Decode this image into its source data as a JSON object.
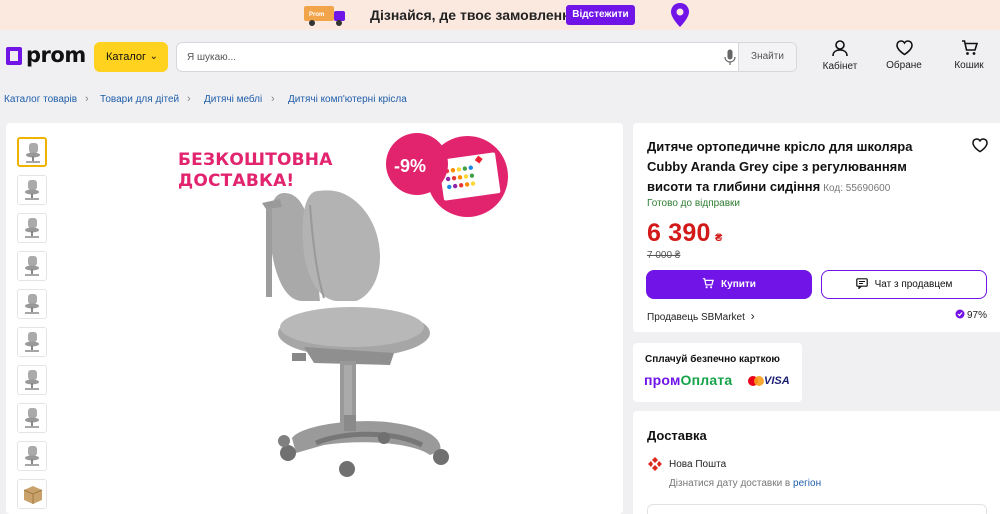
{
  "promo": {
    "truck_label": "Prom",
    "text": "Дізнайся, де твоє замовлення",
    "button": "Відстежити"
  },
  "header": {
    "logo": "prom",
    "catalog_label": "Каталог",
    "search_placeholder": "Я шукаю...",
    "search_button": "Знайти",
    "account_label": "Кабінет",
    "favorites_label": "Обране",
    "cart_label": "Кошик"
  },
  "breadcrumb": [
    "Каталог товарів",
    "Товари для дітей",
    "Дитячі меблі",
    "Дитячі комп'ютерні крісла"
  ],
  "gallery": {
    "banner_line1": "БЕЗКОШТОВНА",
    "banner_line2": "ДОСТАВКА!",
    "discount": "-9%",
    "thumbnail_count": 10
  },
  "product": {
    "title": "Дитяче ортопедичне крісло для школяра Cubby Aranda Grey сіре з регулюванням висоти та глибини сидіння",
    "code": "Код: 55690600",
    "availability": "Готово до відправки",
    "price": "6 390",
    "currency": "₴",
    "old_price": "7 000 ₴",
    "buy_button": "Купити",
    "chat_button": "Чат з продавцем",
    "seller": "Продавець SBMarket",
    "rating": "97%"
  },
  "payment": {
    "title": "Сплачуй безпечно карткою",
    "brand_prefix": "пром",
    "brand_suffix": "Оплата",
    "visa": "VISA"
  },
  "delivery": {
    "title": "Доставка",
    "carrier": "Нова Пошта",
    "date_text": "Дізнатися дату доставки в",
    "date_link": "регіон"
  },
  "colors": {
    "accent": "#7014e8",
    "catalog_button": "#ffd21f",
    "price": "#d21a1a",
    "promo_pink": "#e2236d",
    "available_green": "#2e7d32"
  }
}
